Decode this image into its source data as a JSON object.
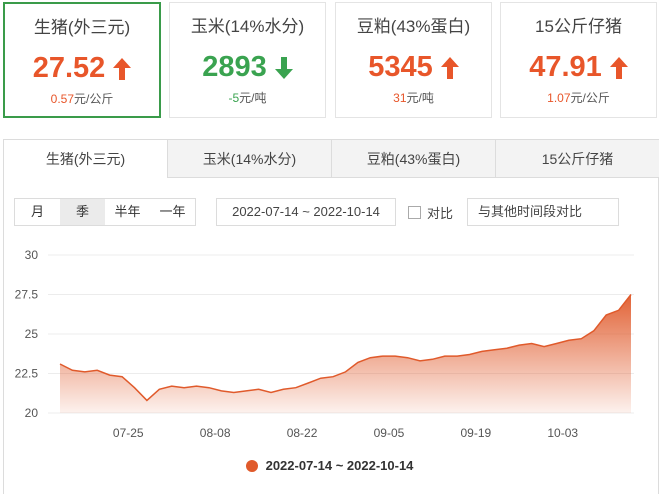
{
  "cards": [
    {
      "title": "生猪(外三元)",
      "price": "27.52",
      "change": "0.57",
      "unit": "元/公斤",
      "direction": "up"
    },
    {
      "title": "玉米(14%水分)",
      "price": "2893",
      "change": "-5",
      "unit": "元/吨",
      "direction": "down"
    },
    {
      "title": "豆粕(43%蛋白)",
      "price": "5345",
      "change": "31",
      "unit": "元/吨",
      "direction": "up"
    },
    {
      "title": "15公斤仔猪",
      "price": "47.91",
      "change": "1.07",
      "unit": "元/公斤",
      "direction": "up"
    }
  ],
  "tabs": [
    "生猪(外三元)",
    "玉米(14%水分)",
    "豆粕(43%蛋白)",
    "15公斤仔猪"
  ],
  "controls": {
    "range_buttons": [
      "月",
      "季",
      "半年",
      "一年"
    ],
    "active_range": "季",
    "date_range": "2022-07-14 ~ 2022-10-14",
    "compare_label": "对比",
    "compare_placeholder": "与其他时间段对比"
  },
  "colors": {
    "accent_up": "#e8562a",
    "accent_down": "#3aa350",
    "active_border": "#3a9b4a",
    "series": "#e05a2b"
  },
  "chart_data": {
    "type": "area",
    "ylim": [
      20,
      30
    ],
    "yticks": [
      20,
      22.5,
      25,
      27.5,
      30
    ],
    "x": [
      "2022-07-14",
      "2022-07-16",
      "2022-07-18",
      "2022-07-20",
      "2022-07-22",
      "2022-07-24",
      "2022-07-26",
      "2022-07-28",
      "2022-07-30",
      "2022-08-01",
      "2022-08-03",
      "2022-08-05",
      "2022-08-07",
      "2022-08-09",
      "2022-08-11",
      "2022-08-13",
      "2022-08-15",
      "2022-08-17",
      "2022-08-19",
      "2022-08-21",
      "2022-08-23",
      "2022-08-25",
      "2022-08-27",
      "2022-08-29",
      "2022-08-31",
      "2022-09-02",
      "2022-09-04",
      "2022-09-06",
      "2022-09-08",
      "2022-09-10",
      "2022-09-12",
      "2022-09-14",
      "2022-09-16",
      "2022-09-18",
      "2022-09-20",
      "2022-09-22",
      "2022-09-24",
      "2022-09-26",
      "2022-09-28",
      "2022-09-30",
      "2022-10-02",
      "2022-10-04",
      "2022-10-06",
      "2022-10-08",
      "2022-10-10",
      "2022-10-12",
      "2022-10-14"
    ],
    "xticks": [
      "07-25",
      "08-08",
      "08-22",
      "09-05",
      "09-19",
      "10-03"
    ],
    "xtick_dates": [
      "2022-07-25",
      "2022-08-08",
      "2022-08-22",
      "2022-09-05",
      "2022-09-19",
      "2022-10-03"
    ],
    "series": [
      {
        "name": "2022-07-14 ~ 2022-10-14",
        "values": [
          23.1,
          22.7,
          22.6,
          22.7,
          22.4,
          22.3,
          21.6,
          20.8,
          21.5,
          21.7,
          21.6,
          21.7,
          21.6,
          21.4,
          21.3,
          21.4,
          21.5,
          21.3,
          21.5,
          21.6,
          21.9,
          22.2,
          22.3,
          22.6,
          23.2,
          23.5,
          23.6,
          23.6,
          23.5,
          23.3,
          23.4,
          23.6,
          23.6,
          23.7,
          23.9,
          24.0,
          24.1,
          24.3,
          24.4,
          24.2,
          24.4,
          24.6,
          24.7,
          25.2,
          26.2,
          26.5,
          27.5
        ]
      }
    ]
  }
}
